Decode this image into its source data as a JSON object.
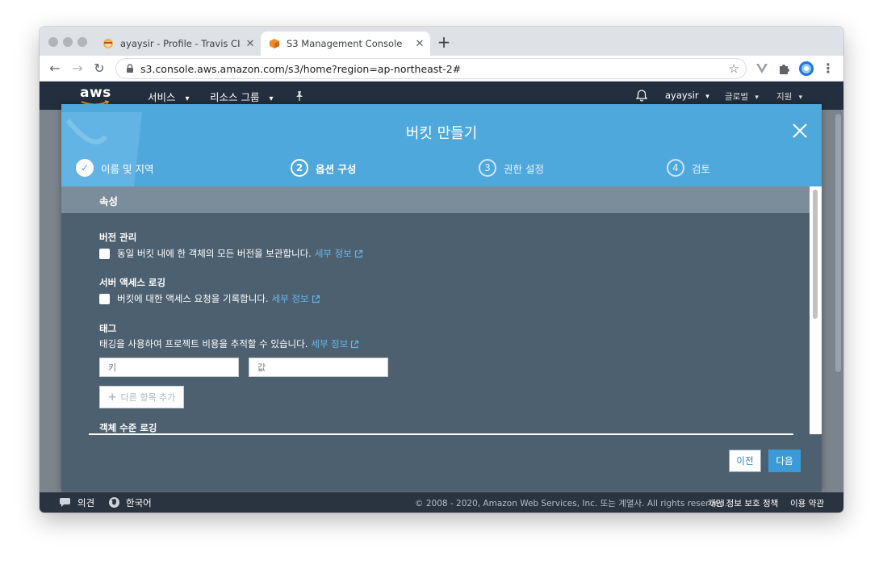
{
  "browser": {
    "tabs": [
      {
        "title": "ayaysir - Profile - Travis CI",
        "active": false
      },
      {
        "title": "S3 Management Console",
        "active": true
      }
    ],
    "url": "s3.console.aws.amazon.com/s3/home?region=ap-northeast-2#"
  },
  "aws_header": {
    "logo": "aws",
    "services": "서비스",
    "resource_groups": "리소스 그룹",
    "account": "ayaysir",
    "region": "글로벌",
    "support": "지원",
    "caret": "▾"
  },
  "modal": {
    "title": "버킷 만들기",
    "steps": [
      {
        "num": "✓",
        "label": "이름 및 지역",
        "state": "done"
      },
      {
        "num": "2",
        "label": "옵션 구성",
        "state": "current"
      },
      {
        "num": "3",
        "label": "권한 설정",
        "state": "pending"
      },
      {
        "num": "4",
        "label": "검토",
        "state": "pending"
      }
    ],
    "section_title": "속성",
    "versioning": {
      "label": "버전 관리",
      "desc": "동일 버킷 내에 한 객체의 모든 버전을 보관합니다.",
      "link": "세부 정보"
    },
    "access_logging": {
      "label": "서버 액세스 로깅",
      "desc": "버킷에 대한 액세스 요청을 기록합니다.",
      "link": "세부 정보"
    },
    "tags": {
      "label": "태그",
      "desc": "태깅을 사용하여 프로젝트 비용을 추적할 수 있습니다.",
      "link": "세부 정보",
      "key_placeholder": "키",
      "value_placeholder": "값",
      "add_label": "다른 항목 추가"
    },
    "object_logging_label": "객체 수준 로깅",
    "prev_label": "이전",
    "next_label": "다음"
  },
  "footer": {
    "feedback": "의견",
    "language": "한국어",
    "copyright": "© 2008 - 2020, Amazon Web Services, Inc. 또는 계열사. All rights reserved.",
    "privacy": "개인 정보 보호 정책",
    "terms": "이용 약관"
  },
  "colors": {
    "modal_header": "#4fa8dc",
    "modal_body": "#4d6070",
    "aws_bar": "#232f3e",
    "link": "#66b7ea",
    "primary_button": "#3b9bd9"
  }
}
